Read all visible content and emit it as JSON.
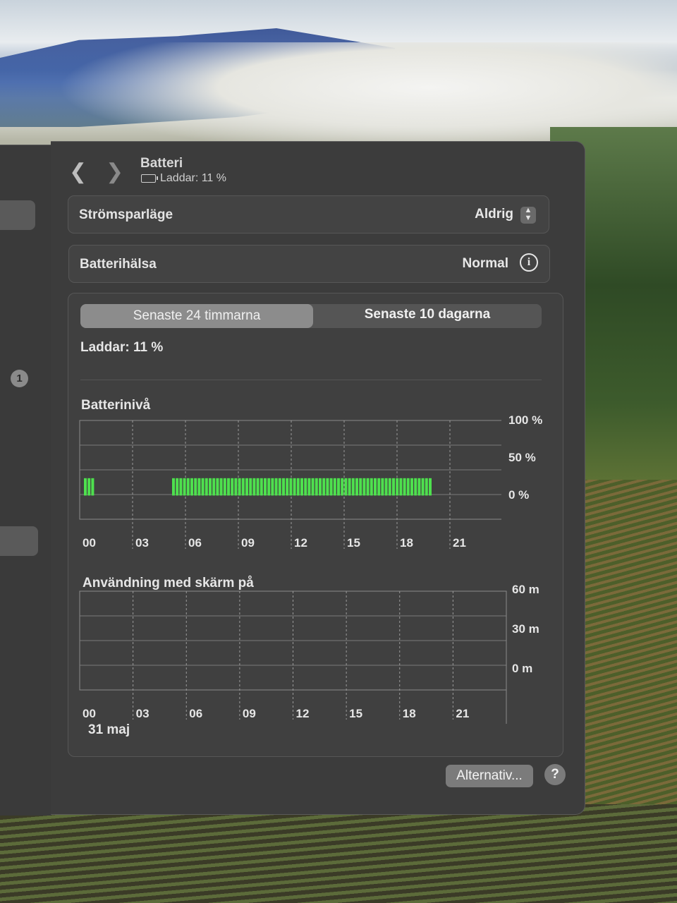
{
  "header": {
    "title": "Batteri",
    "subtitle": "Laddar: 11 %"
  },
  "sidebar": {
    "badge": "1"
  },
  "settings": {
    "power_mode": {
      "label": "Strömsparläge",
      "value": "Aldrig"
    },
    "battery_health": {
      "label": "Batterihälsa",
      "value": "Normal",
      "info_icon": "info-icon"
    }
  },
  "tabs": [
    {
      "label": "Senaste 24 timmarna",
      "selected": true
    },
    {
      "label": "Senaste 10 dagarna",
      "selected": false
    }
  ],
  "status": "Laddar: 11 %",
  "date": "31 maj",
  "footer": {
    "options_label": "Alternativ...",
    "help_label": "?"
  },
  "colors": {
    "charging_bar": "#4ee04e",
    "window_bg": "#3c3c3c",
    "panel_bg": "#404040"
  },
  "chart_data": [
    {
      "type": "bar",
      "title": "Batterinivå",
      "x_tick_labels": [
        "00",
        "03",
        "06",
        "09",
        "12",
        "15",
        "18",
        "21"
      ],
      "y_tick_labels": [
        "100 %",
        "50 %",
        "0 %"
      ],
      "ylim": [
        0,
        100
      ],
      "grid": true,
      "series": [
        {
          "color": "#4ee04e",
          "segments": [
            {
              "start_hour": 0.0,
              "end_hour": 0.75,
              "value": 11
            },
            {
              "start_hour": 5.0,
              "end_hour": 19.8,
              "value": 11
            }
          ]
        }
      ]
    },
    {
      "type": "bar",
      "title": "Användning med skärm på",
      "x_tick_labels": [
        "00",
        "03",
        "06",
        "09",
        "12",
        "15",
        "18",
        "21"
      ],
      "y_tick_labels": [
        "60 m",
        "30 m",
        "0 m"
      ],
      "ylim": [
        0,
        60
      ],
      "grid": true,
      "values": []
    }
  ]
}
